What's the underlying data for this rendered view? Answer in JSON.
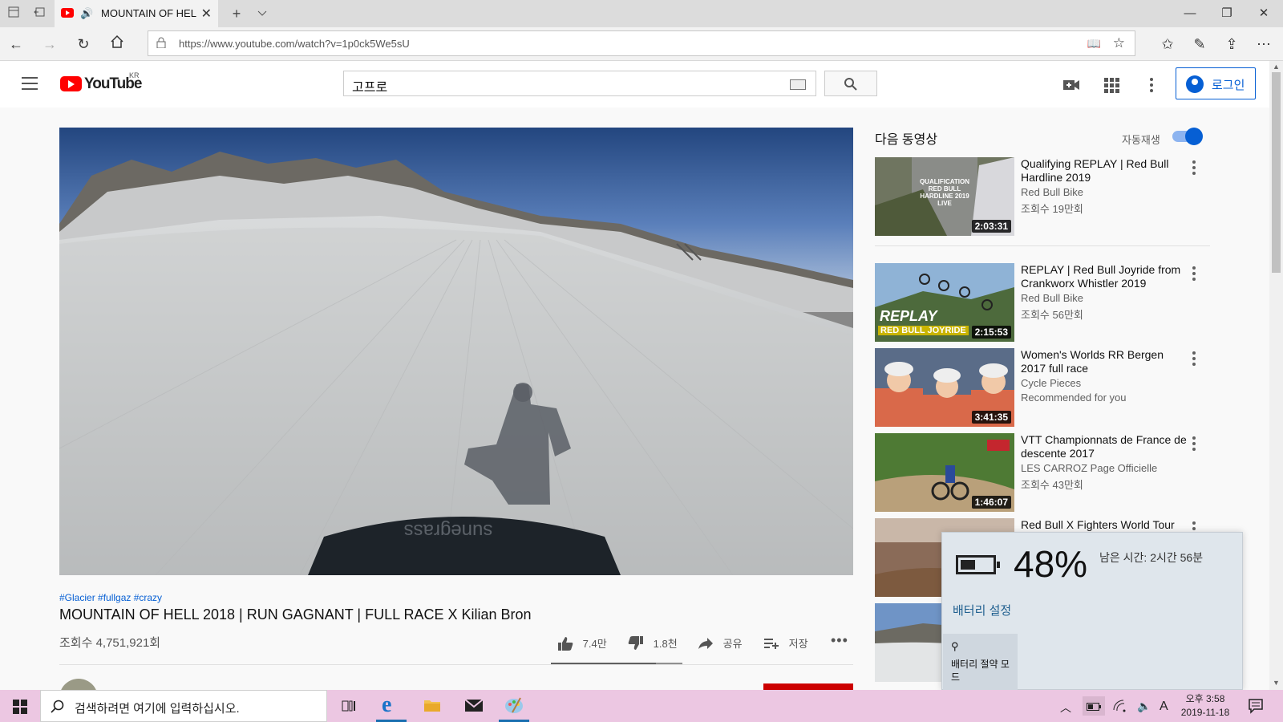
{
  "browser": {
    "tab_title": "MOUNTAIN OF HEL",
    "url": "https://www.youtube.com/watch?v=1p0ck5We5sU"
  },
  "youtube": {
    "logo_text": "YouTube",
    "logo_region": "KR",
    "search_value": "고프로",
    "login_label": "로그인"
  },
  "video": {
    "hashtags": "#Glacier #fullgaz #crazy",
    "title": "MOUNTAIN OF HELL 2018 | RUN GAGNANT | FULL RACE X Kilian Bron",
    "views": "조회수 4,751,921회",
    "likes": "7.4만",
    "dislikes": "1.8천",
    "share_label": "공유",
    "save_label": "저장",
    "like_ratio": 0.8
  },
  "sidebar": {
    "up_next": "다음 동영상",
    "autoplay_label": "자동재생",
    "autoplay_on": true,
    "items": [
      {
        "title": "Qualifying REPLAY | Red Bull Hardline 2019",
        "channel": "Red Bull Bike",
        "meta": "조회수 19만회",
        "duration": "2:03:31",
        "thumb_text": "QUALIFICATION RED BULL HARDLINE 2019 LIVE"
      },
      {
        "title": "REPLAY | Red Bull Joyride from Crankworx Whistler 2019",
        "channel": "Red Bull Bike",
        "meta": "조회수 56만회",
        "duration": "2:15:53",
        "thumb_text": "REPLAY",
        "thumb_sub": "RED BULL JOYRIDE"
      },
      {
        "title": "Women's Worlds RR Bergen 2017 full race",
        "channel": "Cycle Pieces",
        "meta": "Recommended for you",
        "duration": "3:41:35"
      },
      {
        "title": "VTT Championnats de France de descente 2017",
        "channel": "LES CARROZ Page Officielle",
        "meta": "조회수 43만회",
        "duration": "1:46:07"
      },
      {
        "title": "Red Bull X Fighters World Tour",
        "channel": "",
        "meta": "",
        "duration": ""
      }
    ]
  },
  "battery": {
    "percent": "48%",
    "level": 0.48,
    "remaining": "남은 시간: 2시간 56분",
    "settings_link": "배터리 설정",
    "saver_label": "배터리 절약 모드"
  },
  "taskbar": {
    "search_placeholder": "검색하려면 여기에 입력하십시오.",
    "time": "오후 3:58",
    "date": "2019-11-18",
    "ime": "A"
  }
}
